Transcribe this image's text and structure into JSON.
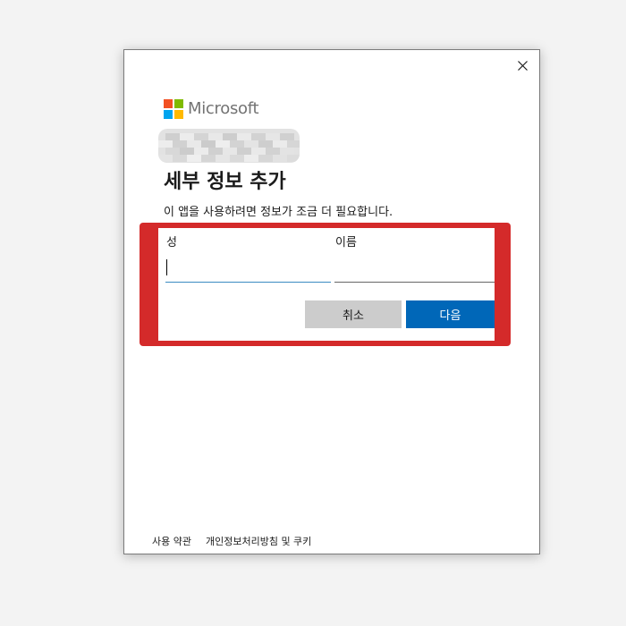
{
  "dialog": {
    "close_label": "×"
  },
  "brand": {
    "name": "Microsoft",
    "logo_colors": [
      "#f25022",
      "#7fba00",
      "#00a4ef",
      "#ffb900"
    ]
  },
  "header": {
    "title": "세부 정보 추가",
    "subtitle": "이 앱을 사용하려면 정보가 조금 더 필요합니다."
  },
  "form": {
    "last_name_label": "성",
    "last_name_value": "",
    "first_name_label": "이름",
    "first_name_value": ""
  },
  "actions": {
    "cancel_label": "취소",
    "next_label": "다음"
  },
  "footer": {
    "terms_label": "사용 약관",
    "privacy_label": "개인정보처리방침 및 쿠키"
  },
  "colors": {
    "accent": "#0067b8",
    "highlight": "#d42a2a",
    "cancel_bg": "#cccccc"
  }
}
